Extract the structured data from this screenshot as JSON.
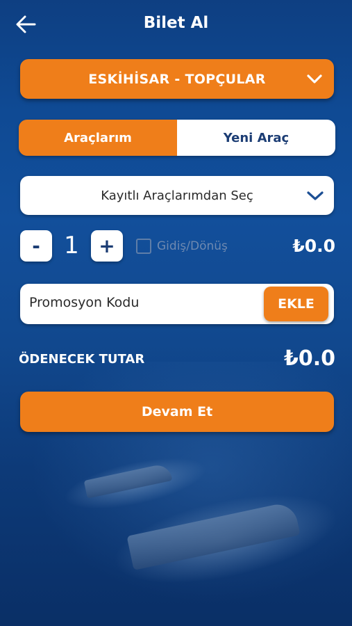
{
  "header": {
    "title": "Bilet Al"
  },
  "route": {
    "selected": "ESKİHİSAR - TOPÇULAR"
  },
  "tabs": [
    {
      "label": "Araçlarım",
      "active": true
    },
    {
      "label": "Yeni Araç",
      "active": false
    }
  ],
  "vehicle": {
    "selected": "Kayıtlı Araçlarımdan Seç"
  },
  "quantity": {
    "minus_label": "-",
    "value": "1",
    "plus_label": "+"
  },
  "roundtrip": {
    "label": "Gidiş/Dönüş",
    "checked": false
  },
  "unit_price": "₺0.0",
  "promo": {
    "placeholder": "Promosyon Kodu",
    "button_label": "EKLE"
  },
  "total": {
    "label": "ÖDENECEK TUTAR",
    "value": "₺0.0"
  },
  "continue_label": "Devam Et",
  "colors": {
    "accent": "#ef7e1a",
    "primary_dark": "#1c3d74",
    "background": "#124f9b"
  },
  "icons": {
    "back": "arrow-left-icon",
    "dropdown": "chevron-down-icon"
  }
}
